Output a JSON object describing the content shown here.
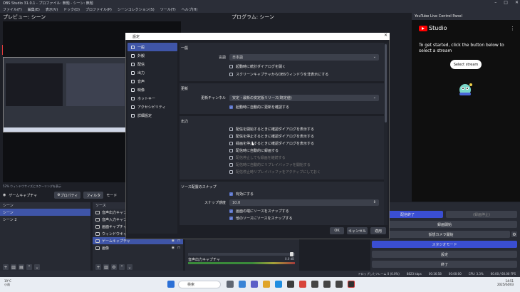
{
  "app": {
    "title": "OBS Studio 31.0.1 - プロファイル: 無題 - シーン: 無題"
  },
  "menu": [
    "ファイル(F)",
    "編集(E)",
    "表示(V)",
    "ドック(D)",
    "プロファイル(P)",
    "シーンコレクション(S)",
    "ツール(T)",
    "ヘルプ(H)"
  ],
  "preview": {
    "title": "プレビュー: シーン",
    "zoom": "52%  ウィンドウサイズにスケーリングを表示"
  },
  "program": {
    "title": "プログラム: シーン"
  },
  "source_toolbar": {
    "current": "ゲームキャプチャ",
    "props": "プロパティ",
    "filters": "フィルタ",
    "mode": "モード"
  },
  "scenes": {
    "title": "シーン",
    "items": [
      "シーン",
      "シーン 2"
    ]
  },
  "sources": {
    "title": "ソース",
    "items": [
      "音声出力キャプチャ",
      "音声入力キャプチャ",
      "画面キャプチャ",
      "ウィンドウキャプチャ",
      "ゲームキャプチャ",
      "画像"
    ]
  },
  "mixer": {
    "item": "音声出力キャプチャ",
    "level": "0.0 dB"
  },
  "controls": {
    "start_stream": "配信終了",
    "start_record": "録画開始",
    "virtual_cam": "仮想カメラ開始",
    "studio_mode": "スタジオモード",
    "settings": "設定",
    "exit": "終了",
    "disabled": "(録画停止)"
  },
  "status": {
    "dropped": "ドロップしたフレーム 0 (0.0%)",
    "bitrate": "8823 kbps",
    "time": "00:16:58",
    "rec": "00:00:00",
    "cpu": "CPU: 3.3%",
    "fps": "60.00 / 60.00 FPS"
  },
  "taskbar": {
    "search": "検索",
    "weather_temp": "19°C",
    "weather_desc": "小雨",
    "time": "14:51",
    "date": "2025/04/03"
  },
  "youtube": {
    "header": "YouTube Live Control Panel",
    "brand": "Studio",
    "message": "To get started, click the button below to select a stream",
    "button": "Select stream"
  },
  "settings": {
    "title": "設定",
    "nav": [
      "一般",
      "外観",
      "配信",
      "出力",
      "音声",
      "映像",
      "ホットキー",
      "アクセシビリティ",
      "詳細設定"
    ],
    "general": {
      "title": "一般",
      "lang_label": "言語",
      "lang_value": "日本語",
      "opts": [
        "起動時に統計ダイアログを開く",
        "スクリーンキャプチャからOBSウィンドウを非表示にする"
      ]
    },
    "update": {
      "title": "更新",
      "channel_label": "更新チャンネル",
      "channel_value": "安定・最新の安定版リリース(既定値)",
      "auto": "起動時に自動的に更新を確認する"
    },
    "output": {
      "title": "出力",
      "opts": [
        "配信を開始するときに確認ダイアログを表示する",
        "配信を停止するときに確認ダイアログを表示する",
        "録画を停止するときに確認ダイアログを表示する",
        "配信時に自動的に録画する",
        "配信停止しても録画を継続する",
        "配信時に自動的にリプレイバッファを開始する",
        "配信停止時リプレイバッファをアクティブにしておく"
      ]
    },
    "snap": {
      "title": "ソース配置のスナップ",
      "enable": "有効にする",
      "sens_label": "スナップ感度",
      "sens_value": "10.0",
      "edge": "画面の端にソースをスナップする",
      "other": "他のソースにソースをスナップする"
    },
    "buttons": {
      "ok": "OK",
      "cancel": "キャンセル",
      "apply": "適用"
    }
  }
}
